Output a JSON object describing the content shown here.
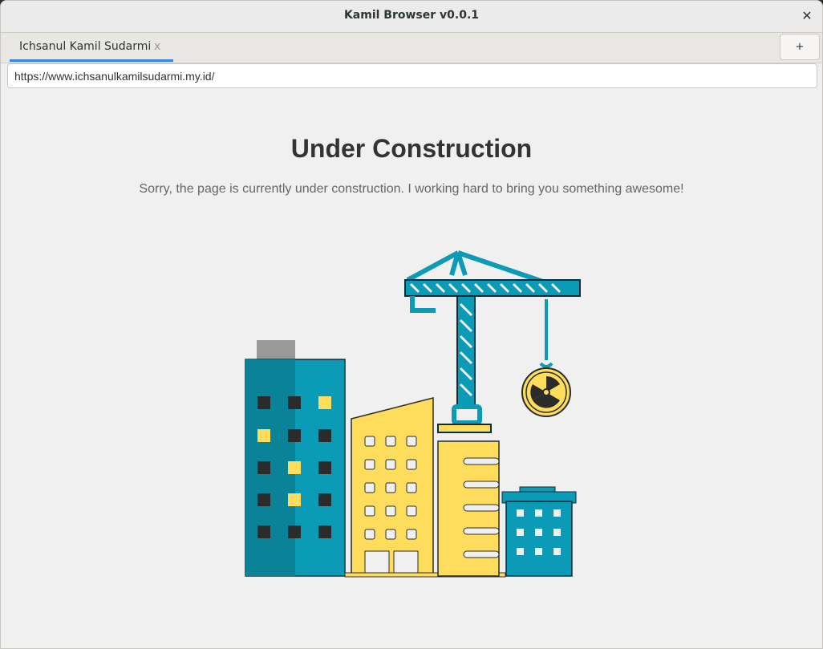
{
  "window": {
    "title": "Kamil Browser v0.0.1",
    "close_label": "✕"
  },
  "tabs": [
    {
      "label": "Ichsanul Kamil Sudarmi",
      "close_label": "x"
    }
  ],
  "new_tab_label": "+",
  "address_bar": {
    "value": "https://www.ichsanulkamilsudarmi.my.id/"
  },
  "page": {
    "title": "Under Construction",
    "subtitle": "Sorry, the page is currently under construction. I working hard to bring you something awesome!"
  },
  "colors": {
    "accent": "#3584e4",
    "building_teal": "#0b9bb7",
    "building_teal_dark": "#0a8399",
    "building_yellow": "#ffdd5c",
    "window_dark": "#2b2b2b",
    "roof_gray": "#999999"
  },
  "icons": {
    "close": "close-icon",
    "new_tab": "plus-icon",
    "hazard": "radiation-icon"
  }
}
